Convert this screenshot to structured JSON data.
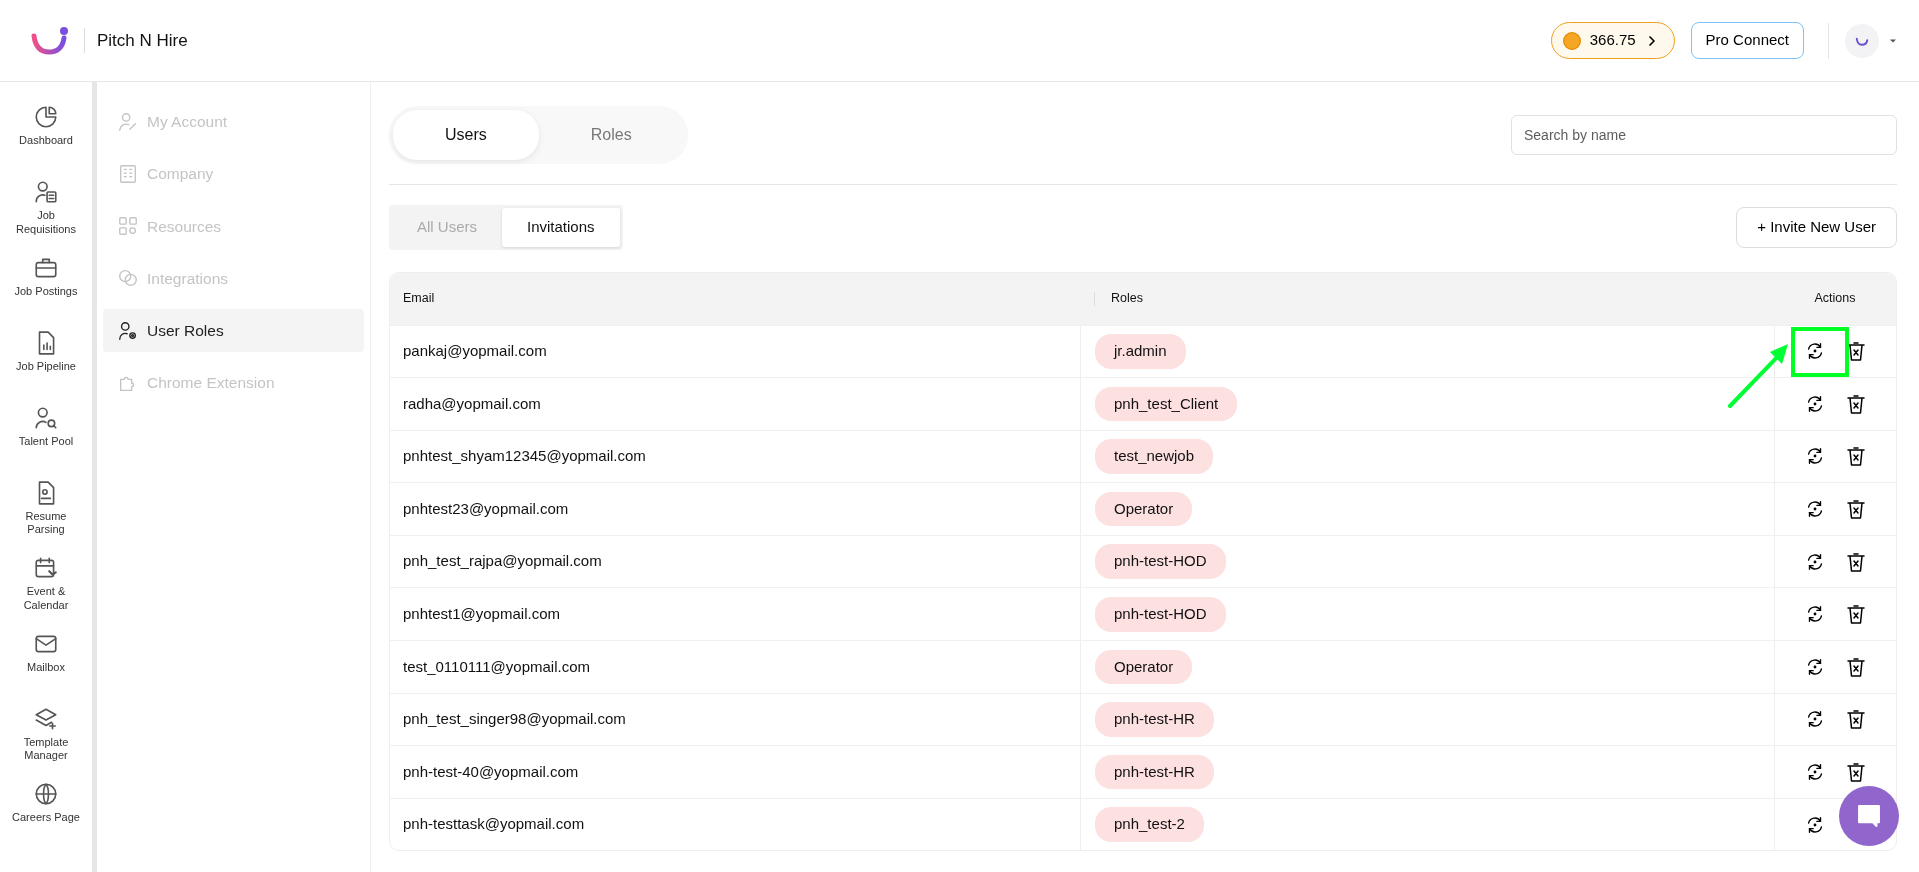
{
  "header": {
    "brand": "Pitch N Hire",
    "credits": "366.75",
    "pro_button": "Pro Connect"
  },
  "nav": [
    {
      "label": "Dashboard"
    },
    {
      "label": "Job Requisitions"
    },
    {
      "label": "Job Postings"
    },
    {
      "label": "Job Pipeline"
    },
    {
      "label": "Talent Pool"
    },
    {
      "label": "Resume Parsing"
    },
    {
      "label": "Event & Calendar"
    },
    {
      "label": "Mailbox"
    },
    {
      "label": "Template Manager"
    },
    {
      "label": "Careers Page"
    }
  ],
  "settings_menu": [
    {
      "label": "My Account",
      "selected": false
    },
    {
      "label": "Company",
      "selected": false
    },
    {
      "label": "Resources",
      "selected": false
    },
    {
      "label": "Integrations",
      "selected": false
    },
    {
      "label": "User Roles",
      "selected": true
    },
    {
      "label": "Chrome Extension",
      "selected": false
    }
  ],
  "tabs": [
    {
      "label": "Users",
      "selected": true
    },
    {
      "label": "Roles",
      "selected": false
    }
  ],
  "search": {
    "placeholder": "Search by name"
  },
  "subtabs": [
    {
      "label": "All Users",
      "selected": false
    },
    {
      "label": "Invitations",
      "selected": true
    }
  ],
  "invite_button": "+ Invite New User",
  "table": {
    "columns": [
      "Email",
      "Roles",
      "Actions"
    ],
    "rows": [
      {
        "email": "pankaj@yopmail.com",
        "role": "jr.admin",
        "highlighted": true
      },
      {
        "email": "radha@yopmail.com",
        "role": "pnh_test_Client",
        "highlighted": false
      },
      {
        "email": "pnhtest_shyam12345@yopmail.com",
        "role": "test_newjob",
        "highlighted": false
      },
      {
        "email": "pnhtest23@yopmail.com",
        "role": "Operator",
        "highlighted": false
      },
      {
        "email": "pnh_test_rajpa@yopmail.com",
        "role": "pnh-test-HOD",
        "highlighted": false
      },
      {
        "email": "pnhtest1@yopmail.com",
        "role": "pnh-test-HOD",
        "highlighted": false
      },
      {
        "email": "test_0110111@yopmail.com",
        "role": "Operator",
        "highlighted": false
      },
      {
        "email": "pnh_test_singer98@yopmail.com",
        "role": "pnh-test-HR",
        "highlighted": false
      },
      {
        "email": "pnh-test-40@yopmail.com",
        "role": "pnh-test-HR",
        "highlighted": false
      },
      {
        "email": "pnh-testtask@yopmail.com",
        "role": "pnh_test-2",
        "highlighted": false
      }
    ]
  }
}
